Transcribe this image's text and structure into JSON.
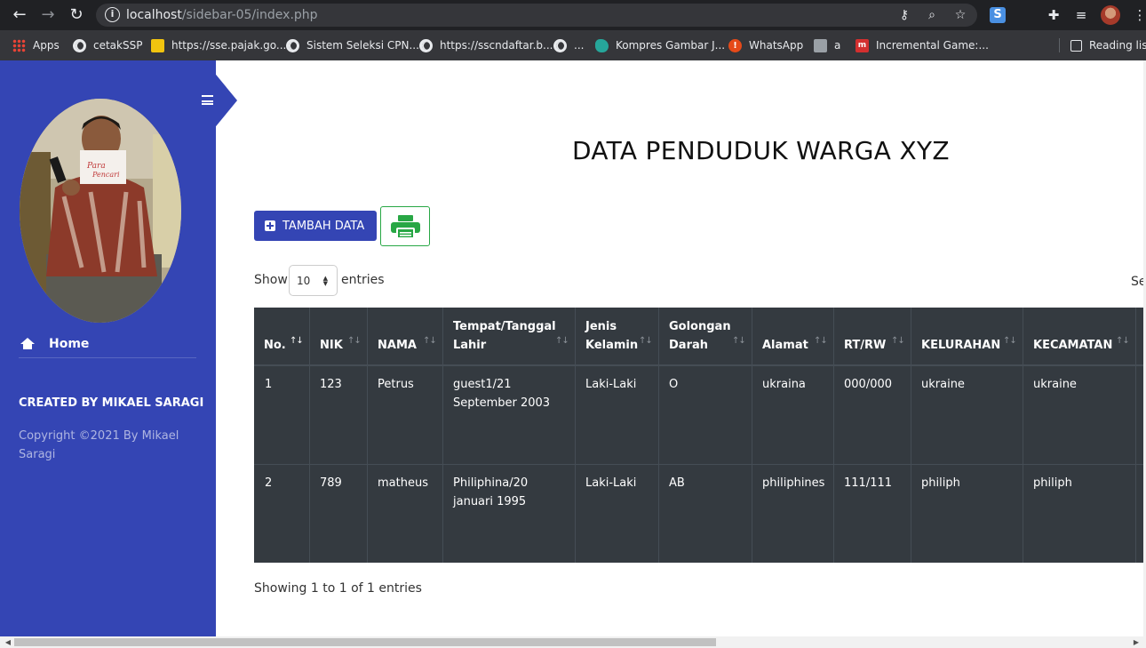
{
  "browser": {
    "url_host": "localhost",
    "url_path": "/sidebar-05/index.php",
    "bookmarks": [
      {
        "label": "Apps",
        "icon": "apps-grid-icon"
      },
      {
        "label": "cetakSSP",
        "icon": "globe-icon"
      },
      {
        "label": "https://sse.pajak.go...",
        "icon": "pajak-icon"
      },
      {
        "label": "Sistem Seleksi CPN...",
        "icon": "globe-icon"
      },
      {
        "label": "https://sscndaftar.b...",
        "icon": "globe-icon"
      },
      {
        "label": "...",
        "icon": "globe-icon"
      },
      {
        "label": "Kompres Gambar J...",
        "icon": "kompres-icon"
      },
      {
        "label": "WhatsApp",
        "icon": "whatsapp-icon"
      },
      {
        "label": "a",
        "icon": "doc-icon"
      },
      {
        "label": "Incremental Game:...",
        "icon": "incremental-icon"
      }
    ],
    "reading_list": "Reading list"
  },
  "sidebar": {
    "menu": [
      {
        "label": "Home",
        "icon": "home-icon"
      }
    ],
    "created_by": "CREATED BY MIKAEL SARAGI",
    "copyright": "Copyright ©2021 By Mikael Saragi"
  },
  "main": {
    "title": "DATA PENDUDUK WARGA XYZ",
    "add_button": "TAMBAH DATA",
    "print_button_icon": "printer-icon",
    "show_label": "Show",
    "page_size": "10",
    "entries_label": "entries",
    "search_label": "Se",
    "showing_text": "Showing 1 to 1 of 1 entries"
  },
  "table": {
    "headers": [
      [
        "No."
      ],
      [
        "NIK"
      ],
      [
        "NAMA"
      ],
      [
        "Tempat/Tanggal",
        "Lahir"
      ],
      [
        "Jenis",
        "Kelamin"
      ],
      [
        "Golongan",
        "Darah"
      ],
      [
        "Alamat"
      ],
      [
        "RT/RW"
      ],
      [
        "KELURAHAN"
      ],
      [
        "KECAMATAN"
      ]
    ],
    "rows": [
      [
        [
          "1"
        ],
        [
          "123"
        ],
        [
          "Petrus"
        ],
        [
          "guest1/21",
          "September 2003"
        ],
        [
          "Laki-Laki"
        ],
        [
          "O"
        ],
        [
          "ukraina"
        ],
        [
          "000/000"
        ],
        [
          "ukraine"
        ],
        [
          "ukraine"
        ]
      ],
      [
        [
          "2"
        ],
        [
          "789"
        ],
        [
          "matheus"
        ],
        [
          "Philiphina/20",
          "januari 1995"
        ],
        [
          "Laki-Laki"
        ],
        [
          "AB"
        ],
        [
          "philiphines"
        ],
        [
          "111/111"
        ],
        [
          "philiph"
        ],
        [
          "philiph"
        ]
      ]
    ]
  },
  "colors": {
    "sidebar": "#3445b4",
    "table_dark": "#343a40",
    "print_green": "#28a745"
  }
}
